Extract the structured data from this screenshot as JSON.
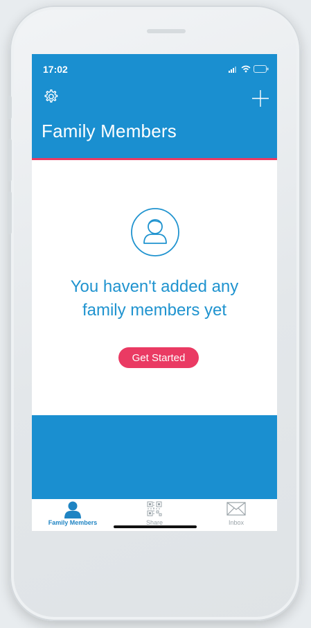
{
  "status_bar": {
    "time": "17:02"
  },
  "header": {
    "title": "Family Members",
    "settings_icon": "gear-icon",
    "add_icon": "plus-icon"
  },
  "empty_state": {
    "icon": "person-icon",
    "message_line1": "You haven't added any",
    "message_line2": "family members yet",
    "cta_label": "Get Started"
  },
  "tabs": [
    {
      "label": "Family Members",
      "icon": "person-icon",
      "active": true
    },
    {
      "label": "Share",
      "icon": "qr-code-icon",
      "active": false
    },
    {
      "label": "Inbox",
      "icon": "envelope-icon",
      "active": false
    }
  ],
  "colors": {
    "primary": "#1a8fd0",
    "accent": "#ea3a63",
    "text_blue": "#1f93cf",
    "inactive_tab": "#9aa3a8"
  }
}
